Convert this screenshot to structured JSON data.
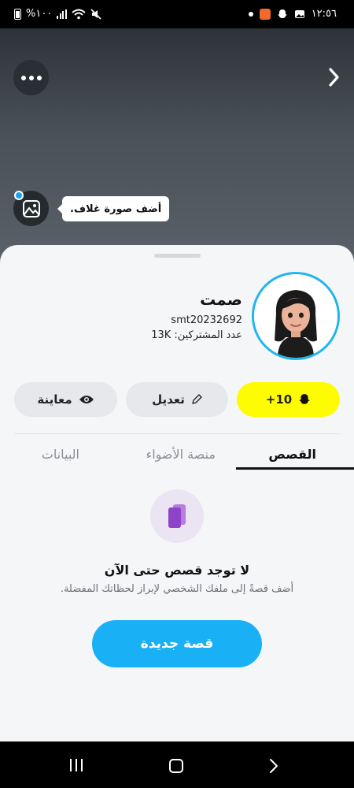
{
  "status_bar": {
    "battery_text": "%١٠٠",
    "time": "١٢:٥٦"
  },
  "cover": {
    "tooltip": "أضف صورة غلاف."
  },
  "profile": {
    "name": "صمت",
    "username": "smt20232692",
    "subscribers_label": "عدد المشتركين:",
    "subscribers_value": "13K"
  },
  "actions": {
    "score_label": "+10",
    "edit_label": "تعديل",
    "preview_label": "معاينة"
  },
  "tabs": [
    {
      "label": "القصص",
      "active": true
    },
    {
      "label": "منصة الأضواء",
      "active": false
    },
    {
      "label": "البيانات",
      "active": false
    }
  ],
  "empty_state": {
    "title": "لا توجد قصص حتى الآن",
    "subtitle": "أضف قصةً إلى ملفك الشخصي لإبراز لحظاتك المفضلة.",
    "button_label": "قصة جديدة"
  },
  "colors": {
    "accent_yellow": "#fffc00",
    "accent_blue": "#1ab0f5",
    "avatar_ring": "#1fb5ef"
  }
}
